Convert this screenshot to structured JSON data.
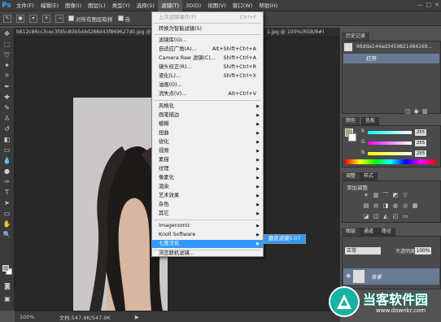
{
  "menubar": {
    "logo": "Ps",
    "items": [
      "文件(F)",
      "编辑(E)",
      "图像(I)",
      "图层(L)",
      "类型(Y)",
      "选择(S)",
      "滤镜(T)",
      "3D(D)",
      "视图(V)",
      "窗口(W)",
      "帮助(H)"
    ],
    "active_index": 6,
    "window_controls": [
      "—",
      "□",
      "✕"
    ]
  },
  "options_bar": {
    "checkbox_label": "对所有图层取样",
    "trailing_label": "自"
  },
  "document": {
    "tab_left": "b812c86cc3cec3fd5c80b5d4d288d43f869627d0.jpg @",
    "tab_right": "1.jpg @ 100%(RGB/8#)",
    "zoom": "100%",
    "doc_info": "文档:547.9K/547.9K"
  },
  "filter_menu": {
    "items": [
      {
        "label": "上次滤镜操作(F)",
        "shortcut": "Ctrl+F",
        "disabled": true
      },
      {
        "label": "转换为智能滤镜(S)"
      },
      {
        "label": "滤镜库(G)..."
      },
      {
        "label": "自适应广角(A)...",
        "shortcut": "Alt+Shift+Ctrl+A"
      },
      {
        "label": "Camera Raw 滤镜(C)...",
        "shortcut": "Shift+Ctrl+A"
      },
      {
        "label": "镜头校正(R)...",
        "shortcut": "Shift+Ctrl+R"
      },
      {
        "label": "液化(L)...",
        "shortcut": "Shift+Ctrl+X"
      },
      {
        "label": "油画(O)..."
      },
      {
        "label": "消失点(V)...",
        "shortcut": "Alt+Ctrl+V"
      },
      {
        "label": "风格化",
        "arrow": "▶"
      },
      {
        "label": "画笔描边",
        "arrow": "▶"
      },
      {
        "label": "模糊",
        "arrow": "▶"
      },
      {
        "label": "扭曲",
        "arrow": "▶"
      },
      {
        "label": "锐化",
        "arrow": "▶"
      },
      {
        "label": "视频",
        "arrow": "▶"
      },
      {
        "label": "素描",
        "arrow": "▶"
      },
      {
        "label": "纹理",
        "arrow": "▶"
      },
      {
        "label": "像素化",
        "arrow": "▶"
      },
      {
        "label": "渲染",
        "arrow": "▶"
      },
      {
        "label": "艺术效果",
        "arrow": "▶"
      },
      {
        "label": "杂色",
        "arrow": "▶"
      },
      {
        "label": "其它",
        "arrow": "▶"
      },
      {
        "label": "Imagenomic",
        "arrow": "▶"
      },
      {
        "label": "Knoll Software",
        "arrow": "▶"
      },
      {
        "label": "七度汉化",
        "arrow": "▶",
        "highlighted": true
      },
      {
        "label": "浏览联机滤镜..."
      }
    ],
    "submenu_item": "磨皮滤镜5.07"
  },
  "history_panel": {
    "tab": "历史记录",
    "snapshot": "96dda144ad3459821484169...",
    "state": "打开"
  },
  "color_panel": {
    "tabs": [
      "颜色",
      "色板"
    ],
    "channels": [
      {
        "label": "R",
        "value": "255"
      },
      {
        "label": "G",
        "value": "255"
      },
      {
        "label": "B",
        "value": "255"
      }
    ]
  },
  "adjust_panel": {
    "tabs": [
      "调整",
      "样式"
    ],
    "title": "添加调整"
  },
  "layers_panel": {
    "tabs": [
      "图层",
      "通道",
      "路径"
    ],
    "blend_mode": "正常",
    "opacity_label": "不透明度:",
    "opacity": "100%",
    "layer_name": "背景"
  },
  "watermark": {
    "brand": "当客软件园",
    "url": "www.downkr.com"
  },
  "colors": {
    "menu_highlight": "#3399ff",
    "panel_selected": "#687a94",
    "brand_teal": "#17b3a0"
  }
}
